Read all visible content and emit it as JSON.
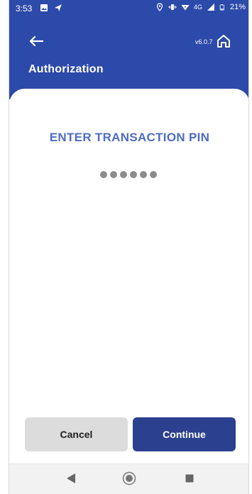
{
  "status_bar": {
    "time": "3:53",
    "network": "4G",
    "battery": "21%",
    "icons": [
      "image-icon",
      "send-icon",
      "location-icon",
      "vibrate-icon",
      "wifi-icon",
      "signal-icon",
      "battery-icon"
    ]
  },
  "header": {
    "version": "v6.0.7",
    "title": "Authorization",
    "background_color": "#2c4aa9",
    "back_icon": "arrow-left-icon",
    "home_icon": "home-icon"
  },
  "pin": {
    "title": "ENTER TRANSACTION PIN",
    "entered_digits": 6,
    "title_color": "#4e6cc2"
  },
  "actions": {
    "cancel_label": "Cancel",
    "continue_label": "Continue",
    "continue_color": "#2c4090"
  },
  "system_nav": {
    "icons": [
      "nav-back-icon",
      "nav-home-icon",
      "nav-recents-icon"
    ]
  }
}
